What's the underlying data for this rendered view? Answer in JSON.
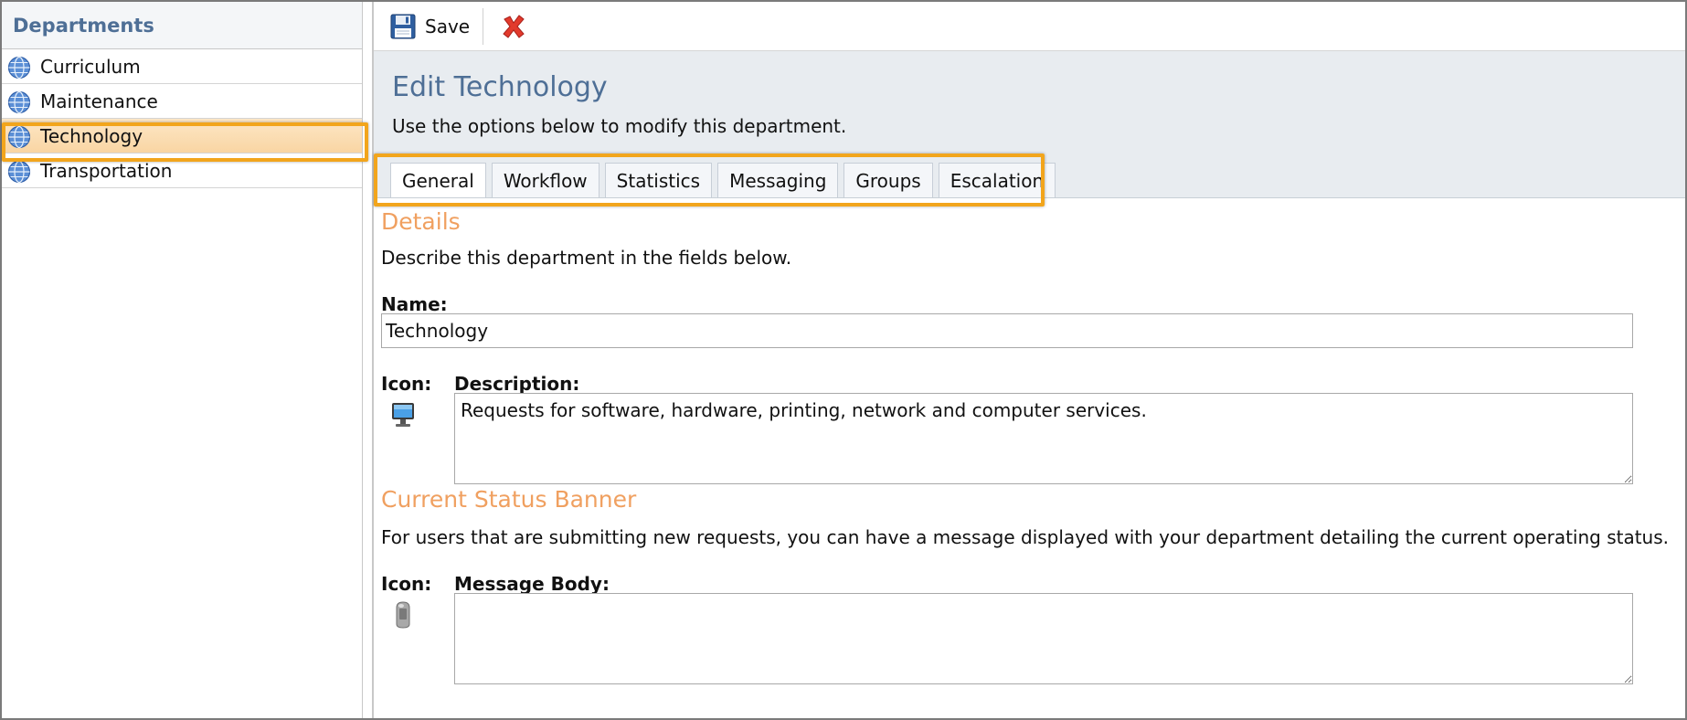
{
  "sidebar": {
    "header": "Departments",
    "items": [
      {
        "label": "Curriculum"
      },
      {
        "label": "Maintenance"
      },
      {
        "label": "Technology"
      },
      {
        "label": "Transportation"
      }
    ]
  },
  "toolbar": {
    "save_label": "Save"
  },
  "edit": {
    "title": "Edit Technology",
    "subtitle": "Use the options below to modify this department."
  },
  "tabs": [
    {
      "label": "General"
    },
    {
      "label": "Workflow"
    },
    {
      "label": "Statistics"
    },
    {
      "label": "Messaging"
    },
    {
      "label": "Groups"
    },
    {
      "label": "Escalation"
    }
  ],
  "details": {
    "title": "Details",
    "description": "Describe this department in the fields below.",
    "name_label": "Name:",
    "name_value": "Technology",
    "icon_label": "Icon:",
    "description_label": "Description:",
    "description_value": "Requests for software, hardware, printing, network and computer services."
  },
  "status_banner": {
    "title": "Current Status Banner",
    "description": "For users that are submitting new requests, you can have a message displayed with your department detailing the current operating status.",
    "icon_label": "Icon:",
    "message_label": "Message Body:",
    "message_value": ""
  },
  "colors": {
    "accent_blue": "#4e6f96",
    "section_orange": "#f0a060",
    "highlight": "#f2a51c"
  }
}
